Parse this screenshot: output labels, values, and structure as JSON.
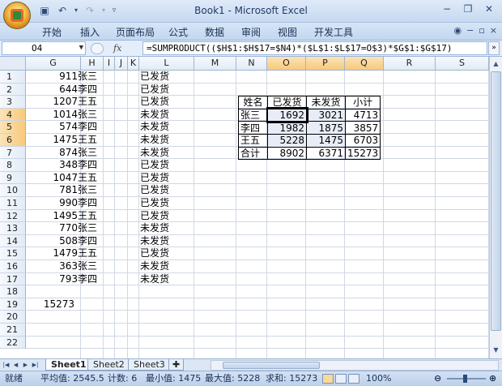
{
  "window": {
    "title": "Book1 - Microsoft Excel"
  },
  "quick_access": [
    "save-icon",
    "undo-icon",
    "redo-icon"
  ],
  "ribbon_tabs": [
    "开始",
    "插入",
    "页面布局",
    "公式",
    "数据",
    "审阅",
    "视图",
    "开发工具"
  ],
  "formula_bar": {
    "name_box": "O4",
    "fx": "fx",
    "formula": "=SUMPRODUCT(($H$1:$H$17=$N4)*($L$1:$L$17=O$3)*$G$1:$G$17)"
  },
  "columns": [
    "G",
    "H",
    "I",
    "J",
    "K",
    "L",
    "M",
    "N",
    "O",
    "P",
    "Q",
    "R",
    "S"
  ],
  "rows": [
    "1",
    "2",
    "3",
    "4",
    "5",
    "6",
    "7",
    "8",
    "9",
    "10",
    "11",
    "12",
    "13",
    "14",
    "15",
    "16",
    "17",
    "18",
    "19",
    "20",
    "21",
    "22"
  ],
  "data_rows": [
    {
      "g": "911",
      "h": "张三",
      "l": "已发货"
    },
    {
      "g": "644",
      "h": "李四",
      "l": "已发货"
    },
    {
      "g": "1207",
      "h": "王五",
      "l": "已发货"
    },
    {
      "g": "1014",
      "h": "张三",
      "l": "未发货"
    },
    {
      "g": "574",
      "h": "李四",
      "l": "未发货"
    },
    {
      "g": "1475",
      "h": "王五",
      "l": "未发货"
    },
    {
      "g": "874",
      "h": "张三",
      "l": "未发货"
    },
    {
      "g": "348",
      "h": "李四",
      "l": "已发货"
    },
    {
      "g": "1047",
      "h": "王五",
      "l": "已发货"
    },
    {
      "g": "781",
      "h": "张三",
      "l": "已发货"
    },
    {
      "g": "990",
      "h": "李四",
      "l": "已发货"
    },
    {
      "g": "1495",
      "h": "王五",
      "l": "已发货"
    },
    {
      "g": "770",
      "h": "张三",
      "l": "未发货"
    },
    {
      "g": "508",
      "h": "李四",
      "l": "未发货"
    },
    {
      "g": "1479",
      "h": "王五",
      "l": "已发货"
    },
    {
      "g": "363",
      "h": "张三",
      "l": "未发货"
    },
    {
      "g": "793",
      "h": "李四",
      "l": "未发货"
    }
  ],
  "g19_total": "15273",
  "summary_table": {
    "header": [
      "姓名",
      "已发货",
      "未发货",
      "小计"
    ],
    "rows": [
      [
        "张三",
        "1692",
        "3021",
        "4713"
      ],
      [
        "李四",
        "1982",
        "1875",
        "3857"
      ],
      [
        "王五",
        "5228",
        "1475",
        "6703"
      ],
      [
        "合计",
        "8902",
        "6371",
        "15273"
      ]
    ]
  },
  "sheet_tabs": [
    "Sheet1",
    "Sheet2",
    "Sheet3"
  ],
  "status_bar": {
    "mode": "就绪",
    "average": "平均值: 2545.5",
    "count": "计数: 6",
    "min": "最小值: 1475",
    "max": "最大值: 5228",
    "sum": "求和: 15273",
    "zoom": "100%"
  }
}
